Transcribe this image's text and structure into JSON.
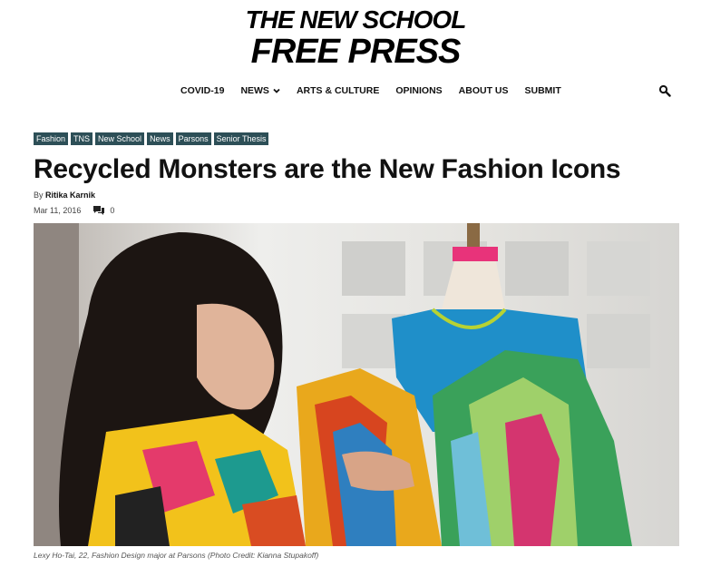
{
  "logo": {
    "line1": "THE NEW SCHOOL",
    "line2": "FREE PRESS"
  },
  "nav": {
    "items": [
      {
        "label": "COVID-19"
      },
      {
        "label": "NEWS"
      },
      {
        "label": "ARTS & CULTURE"
      },
      {
        "label": "OPINIONS"
      },
      {
        "label": "ABOUT US"
      },
      {
        "label": "SUBMIT"
      }
    ],
    "search_icon": "search-icon"
  },
  "article": {
    "tags": [
      "Fashion",
      "TNS",
      "New School",
      "News",
      "Parsons",
      "Senior Thesis"
    ],
    "title": "Recycled Monsters are the New Fashion Icons",
    "by_label": "By",
    "author": "Ritika Karnik",
    "date": "Mar 11, 2016",
    "comment_count": "0",
    "caption": "Lexy Ho-Tai, 22, Fashion Design major at Parsons (Photo Credit: Kianna Stupakoff)"
  },
  "colors": {
    "tag_bg": "#2d4f57",
    "text": "#111111"
  }
}
